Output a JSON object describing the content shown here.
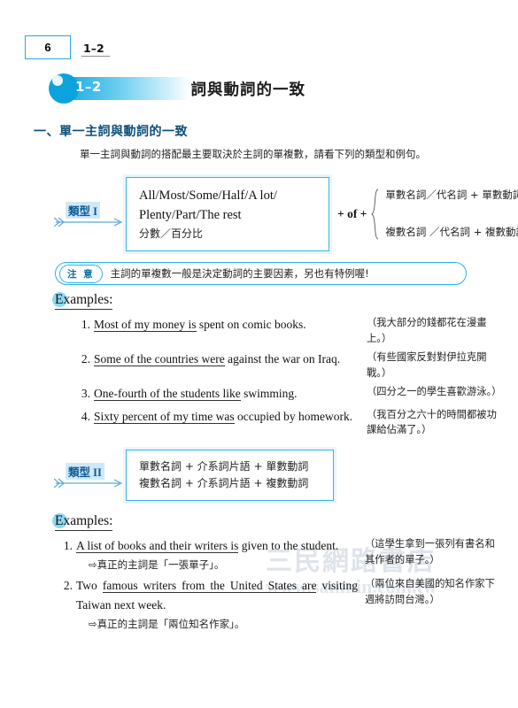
{
  "runhead": {
    "page_number": "6",
    "section_ref": "1–2"
  },
  "banner": {
    "badge_label": "1–2",
    "title": "主詞與動詞的一致"
  },
  "section": {
    "heading": "一、單一主詞與動詞的一致",
    "intro": "單一主詞與動詞的搭配最主要取決於主詞的單複數，請看下列的類型和例句。"
  },
  "type1": {
    "label": "類型 I",
    "box_lines_en": [
      "All/Most/Some/Half/A lot/",
      "Plenty/Part/The rest"
    ],
    "box_line_cn": "分數／百分比",
    "joiner": "+ of +",
    "brace_lines": [
      "單數名詞／代名詞 + 單數動詞",
      "複數名詞 ／代名詞 + 複數動詞"
    ]
  },
  "note": {
    "tag": "注 意",
    "text": "主詞的單複數一般是決定動詞的主要因素，另也有特例喔!"
  },
  "examples1": {
    "heading": "Examples:",
    "items": [
      {
        "num": "1.",
        "parts": [
          {
            "t": "Most of ",
            "u": true
          },
          {
            "t": " ",
            "u": false
          },
          {
            "t": "my money ",
            "u": true
          },
          {
            "t": " ",
            "u": false
          },
          {
            "t": "is",
            "u": true
          },
          {
            "t": " spent on comic books.",
            "u": false
          }
        ],
        "cn": "（我大部分的錢都花在漫畫上。）"
      },
      {
        "num": "2.",
        "parts": [
          {
            "t": "Some of ",
            "u": true
          },
          {
            "t": " ",
            "u": false
          },
          {
            "t": "the countries ",
            "u": true
          },
          {
            "t": " ",
            "u": false
          },
          {
            "t": "were",
            "u": true
          },
          {
            "t": " against the war on Iraq.",
            "u": false
          }
        ],
        "cn": "（有些國家反對對伊拉克開戰。）"
      },
      {
        "num": "3.",
        "parts": [
          {
            "t": "One-fourth of ",
            "u": true
          },
          {
            "t": " ",
            "u": false
          },
          {
            "t": "the students ",
            "u": true
          },
          {
            "t": " ",
            "u": false
          },
          {
            "t": "like",
            "u": true
          },
          {
            "t": " swimming.",
            "u": false
          }
        ],
        "cn": "（四分之一的學生喜歡游泳。）"
      },
      {
        "num": "4.",
        "parts": [
          {
            "t": "Sixty percent of ",
            "u": true
          },
          {
            "t": " ",
            "u": false
          },
          {
            "t": "my time ",
            "u": true
          },
          {
            "t": " ",
            "u": false
          },
          {
            "t": "was",
            "u": true
          },
          {
            "t": " occupied by homework.",
            "u": false
          }
        ],
        "cn": "（我百分之六十的時間都被功課給佔滿了。）"
      }
    ]
  },
  "type2": {
    "label": "類型 II",
    "box_lines_cn": [
      "單數名詞 + 介系詞片語 + 單數動詞",
      "複數名詞 + 介系詞片語 + 複數動詞"
    ]
  },
  "examples2": {
    "heading": "Examples:",
    "items": [
      {
        "num": "1.",
        "parts": [
          {
            "t": "A list ",
            "u": true
          },
          {
            "t": " ",
            "u": false
          },
          {
            "t": "of books and their writers ",
            "u": true
          },
          {
            "t": " ",
            "u": false
          },
          {
            "t": "is",
            "u": true
          },
          {
            "t": " given to the student.",
            "u": false
          }
        ],
        "arrow": "⇨真正的主詞是「一張單子」。",
        "cn": "（這學生拿到一張列有書名和其作者的單子。）"
      },
      {
        "num": "2.",
        "parts": [
          {
            "t": "Two ",
            "u": false
          },
          {
            "t": "famous writers ",
            "u": true
          },
          {
            "t": " ",
            "u": false
          },
          {
            "t": "from the United States ",
            "u": true
          },
          {
            "t": " ",
            "u": false
          },
          {
            "t": "are",
            "u": true
          },
          {
            "t": " visiting Taiwan next week.",
            "u": false
          }
        ],
        "arrow": "⇨真正的主詞是「兩位知名作家」。",
        "cn": "（兩位來自美國的知名作家下週將訪問台灣。）"
      }
    ]
  },
  "watermark": {
    "cn": "三民網路書店",
    "url": "www.sanmin.com.tw"
  },
  "colors": {
    "accent_blue": "#2aa8d8",
    "banner_blue": "#0aa3dd",
    "heading_blue": "#0d4f7a",
    "box_border": "#39b3e3"
  }
}
